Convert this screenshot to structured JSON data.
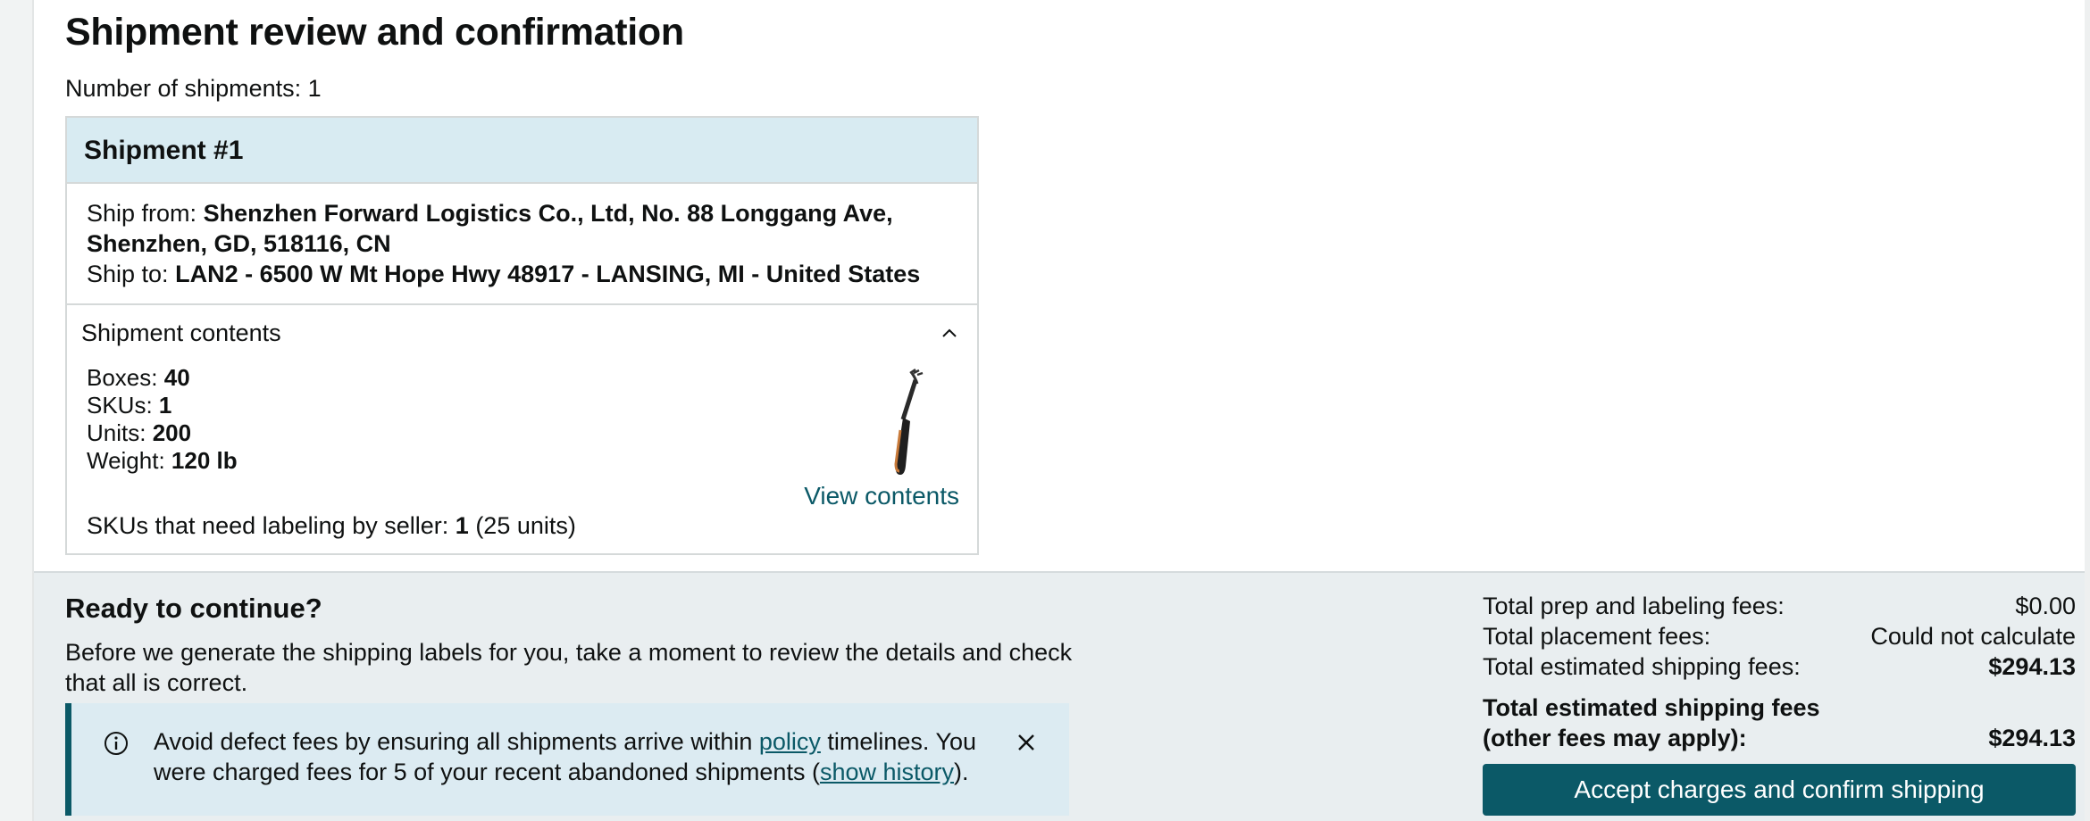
{
  "page": {
    "title": "Shipment review and confirmation",
    "shipments_label": "Number of shipments:",
    "shipments_count": "1"
  },
  "shipment": {
    "heading": "Shipment #1",
    "ship_from_label": "Ship from:",
    "ship_from_value": "Shenzhen Forward Logistics Co., Ltd, No. 88 Longgang Ave, Shenzhen, GD, 518116, CN",
    "ship_to_label": "Ship to:",
    "ship_to_value": "LAN2 - 6500 W Mt Hope Hwy 48917 - LANSING, MI - United States",
    "contents_heading": "Shipment contents",
    "boxes_label": "Boxes:",
    "boxes_value": "40",
    "skus_label": "SKUs:",
    "skus_value": "1",
    "units_label": "Units:",
    "units_value": "200",
    "weight_label": "Weight:",
    "weight_value": "120 lb",
    "view_contents_label": "View contents",
    "labeling_label": "SKUs that need labeling by seller:",
    "labeling_count": "1",
    "labeling_units": "(25 units)",
    "product_icon": "garden-hand-rake"
  },
  "ready": {
    "title": "Ready to continue?",
    "text": "Before we generate the shipping labels for you, take a moment to review the details and check that all is correct."
  },
  "alert": {
    "icon": "info-icon",
    "text_part1": "Avoid defect fees by ensuring all shipments arrive within ",
    "policy_link": "policy",
    "text_part2": " timelines. You were charged fees for 5 of your recent abandoned shipments (",
    "history_link": "show history",
    "text_part3": ")."
  },
  "fees": {
    "prep_label": "Total prep and labeling fees:",
    "prep_value": "$0.00",
    "placement_label": "Total placement fees:",
    "placement_value": "Could not calculate",
    "shipping_label": "Total estimated shipping fees:",
    "shipping_value": "$294.13",
    "total_label": "Total estimated shipping fees (other fees may apply):",
    "total_value": "$294.13"
  },
  "actions": {
    "accept_label": "Accept charges and confirm shipping"
  },
  "colors": {
    "accent": "#0b5967",
    "header_bg": "#d8ebf2",
    "panel_bg": "#e9eef0"
  }
}
